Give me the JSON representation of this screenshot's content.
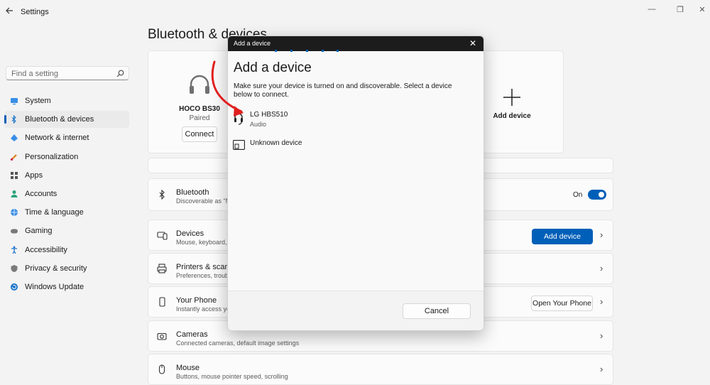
{
  "window": {
    "title": "Settings"
  },
  "sidebar": {
    "search_placeholder": "Find a setting",
    "items": [
      {
        "label": "System",
        "icon": "monitor-icon",
        "active": false
      },
      {
        "label": "Bluetooth & devices",
        "icon": "bluetooth-icon",
        "active": true
      },
      {
        "label": "Network & internet",
        "icon": "wifi-icon",
        "active": false
      },
      {
        "label": "Personalization",
        "icon": "brush-icon",
        "active": false
      },
      {
        "label": "Apps",
        "icon": "apps-icon",
        "active": false
      },
      {
        "label": "Accounts",
        "icon": "person-icon",
        "active": false
      },
      {
        "label": "Time & language",
        "icon": "globe-icon",
        "active": false
      },
      {
        "label": "Gaming",
        "icon": "gamepad-icon",
        "active": false
      },
      {
        "label": "Accessibility",
        "icon": "accessibility-icon",
        "active": false
      },
      {
        "label": "Privacy & security",
        "icon": "shield-icon",
        "active": false
      },
      {
        "label": "Windows Update",
        "icon": "update-icon",
        "active": false
      }
    ]
  },
  "main": {
    "title": "Bluetooth & devices",
    "device_card": {
      "name": "HOCO BS30",
      "status": "Paired",
      "button": "Connect"
    },
    "add_card": {
      "label": "Add device"
    },
    "bluetooth_row": {
      "title": "Bluetooth",
      "subtitle": "Discoverable as \"MS",
      "toggle_label": "On",
      "toggle_on": true
    },
    "rows": [
      {
        "title": "Devices",
        "subtitle": "Mouse, keyboard, pe",
        "button": "Add device",
        "icon": "devices-icon"
      },
      {
        "title": "Printers & scanners",
        "subtitle": "Preferences, troubles",
        "button": "",
        "icon": "printer-icon"
      },
      {
        "title": "Your Phone",
        "subtitle": "Instantly access your",
        "button": "Open Your Phone",
        "icon": "phone-icon"
      },
      {
        "title": "Cameras",
        "subtitle": "Connected cameras, default image settings",
        "button": "",
        "icon": "camera-icon"
      },
      {
        "title": "Mouse",
        "subtitle": "Buttons, mouse pointer speed, scrolling",
        "button": "",
        "icon": "mouse-icon"
      }
    ]
  },
  "dialog": {
    "header": "Add a device",
    "title": "Add a device",
    "description": "Make sure your device is turned on and discoverable. Select a device below to connect.",
    "devices": [
      {
        "name": "LG HBS510",
        "type": "Audio",
        "icon": "headset-icon"
      },
      {
        "name": "Unknown device",
        "type": "",
        "icon": "unknown-device-icon"
      }
    ],
    "cancel": "Cancel"
  },
  "colors": {
    "accent": "#005fb8",
    "annotation": "#e0201f"
  }
}
